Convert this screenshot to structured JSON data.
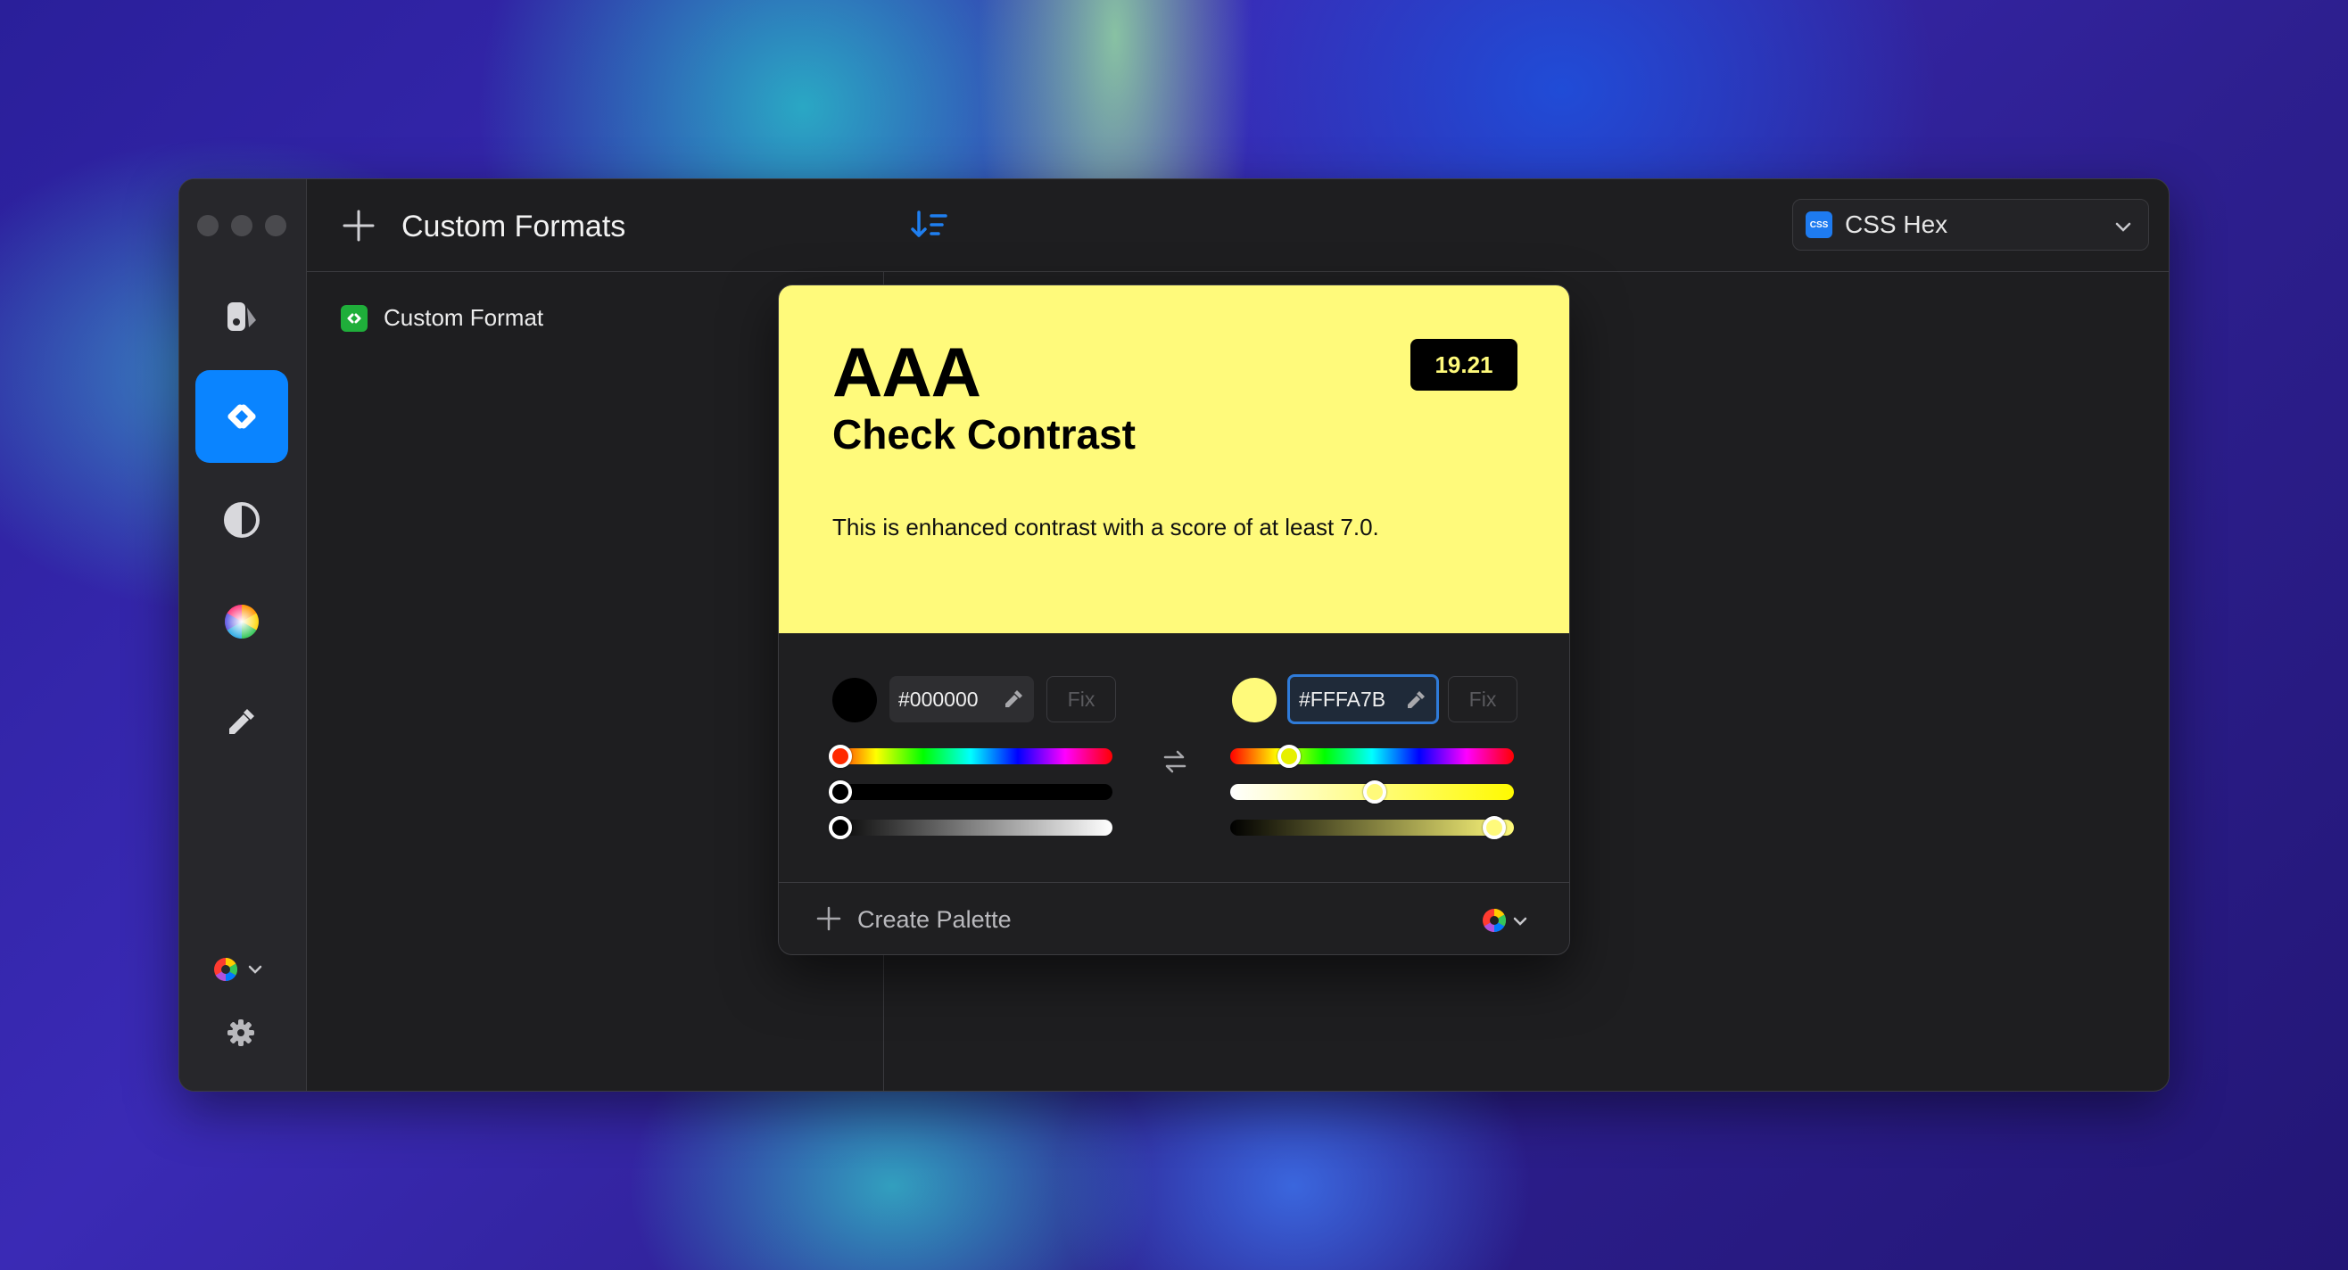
{
  "header": {
    "title": "Custom Formats",
    "format_selector": {
      "badge": "CSS",
      "label": "CSS Hex"
    }
  },
  "sidebar": {
    "items": [
      {
        "name": "pick-colors",
        "icon": "eyedropper-palette-icon"
      },
      {
        "name": "custom-formats",
        "icon": "code-format-icon",
        "active": true
      },
      {
        "name": "contrast-checker",
        "icon": "contrast-icon"
      },
      {
        "name": "color-wheel",
        "icon": "color-wheel-icon"
      },
      {
        "name": "color-picker",
        "icon": "eyedropper-icon"
      }
    ],
    "bottom": [
      {
        "name": "palette-menu",
        "icon": "color-wheel-icon"
      },
      {
        "name": "settings",
        "icon": "gear-icon"
      }
    ]
  },
  "list": {
    "items": [
      {
        "label": "Custom Format"
      }
    ]
  },
  "contrast": {
    "grade": "AAA",
    "title": "Check Contrast",
    "score": "19.21",
    "description": "This is enhanced contrast with a score of at least 7.0.",
    "foreground": {
      "hex": "#000000",
      "fix_label": "Fix",
      "hue": 0.0,
      "saturation": 0.0,
      "lightness": 0.0
    },
    "background": {
      "hex": "#FFFA7B",
      "fix_label": "Fix",
      "hue": 0.18,
      "saturation": 0.51,
      "lightness": 0.97
    },
    "create_palette_label": "Create Palette"
  },
  "colors": {
    "accent": "#0A84FF",
    "contrast_bg": "#FFFA7B",
    "contrast_fg": "#000000"
  }
}
